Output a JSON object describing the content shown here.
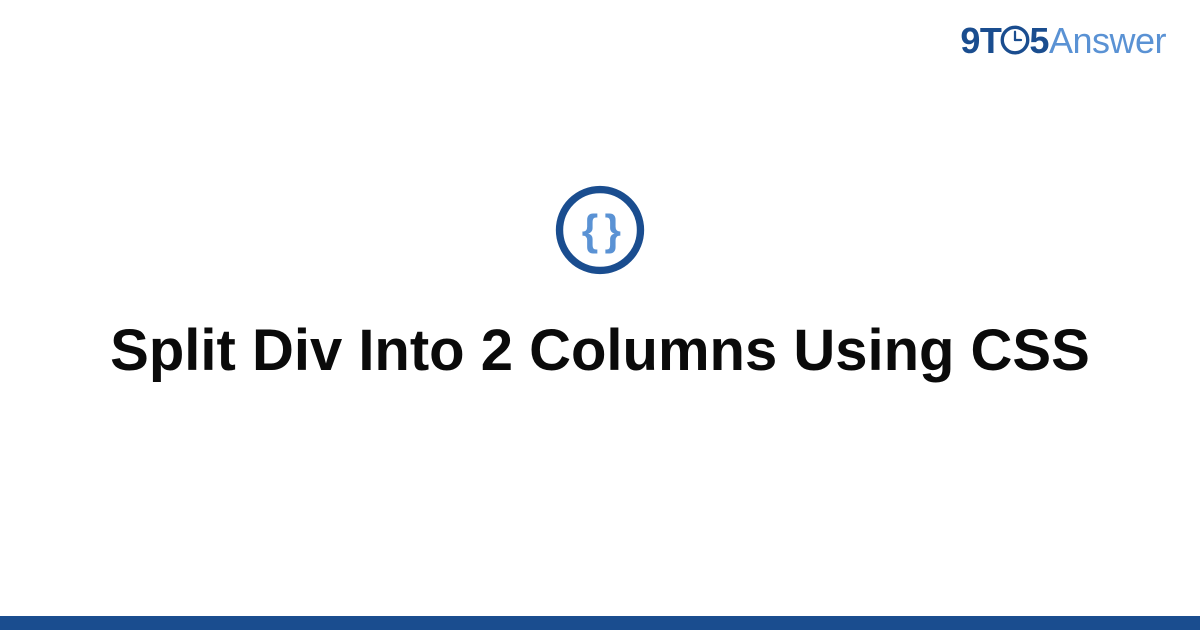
{
  "header": {
    "logo_prefix": "9T",
    "logo_suffix": "5",
    "logo_answer": "Answer"
  },
  "main": {
    "title": "Split Div Into 2 Columns Using CSS",
    "icon_name": "code-braces-icon"
  },
  "colors": {
    "brand_dark": "#1a4d8f",
    "brand_light": "#5a92d4"
  }
}
